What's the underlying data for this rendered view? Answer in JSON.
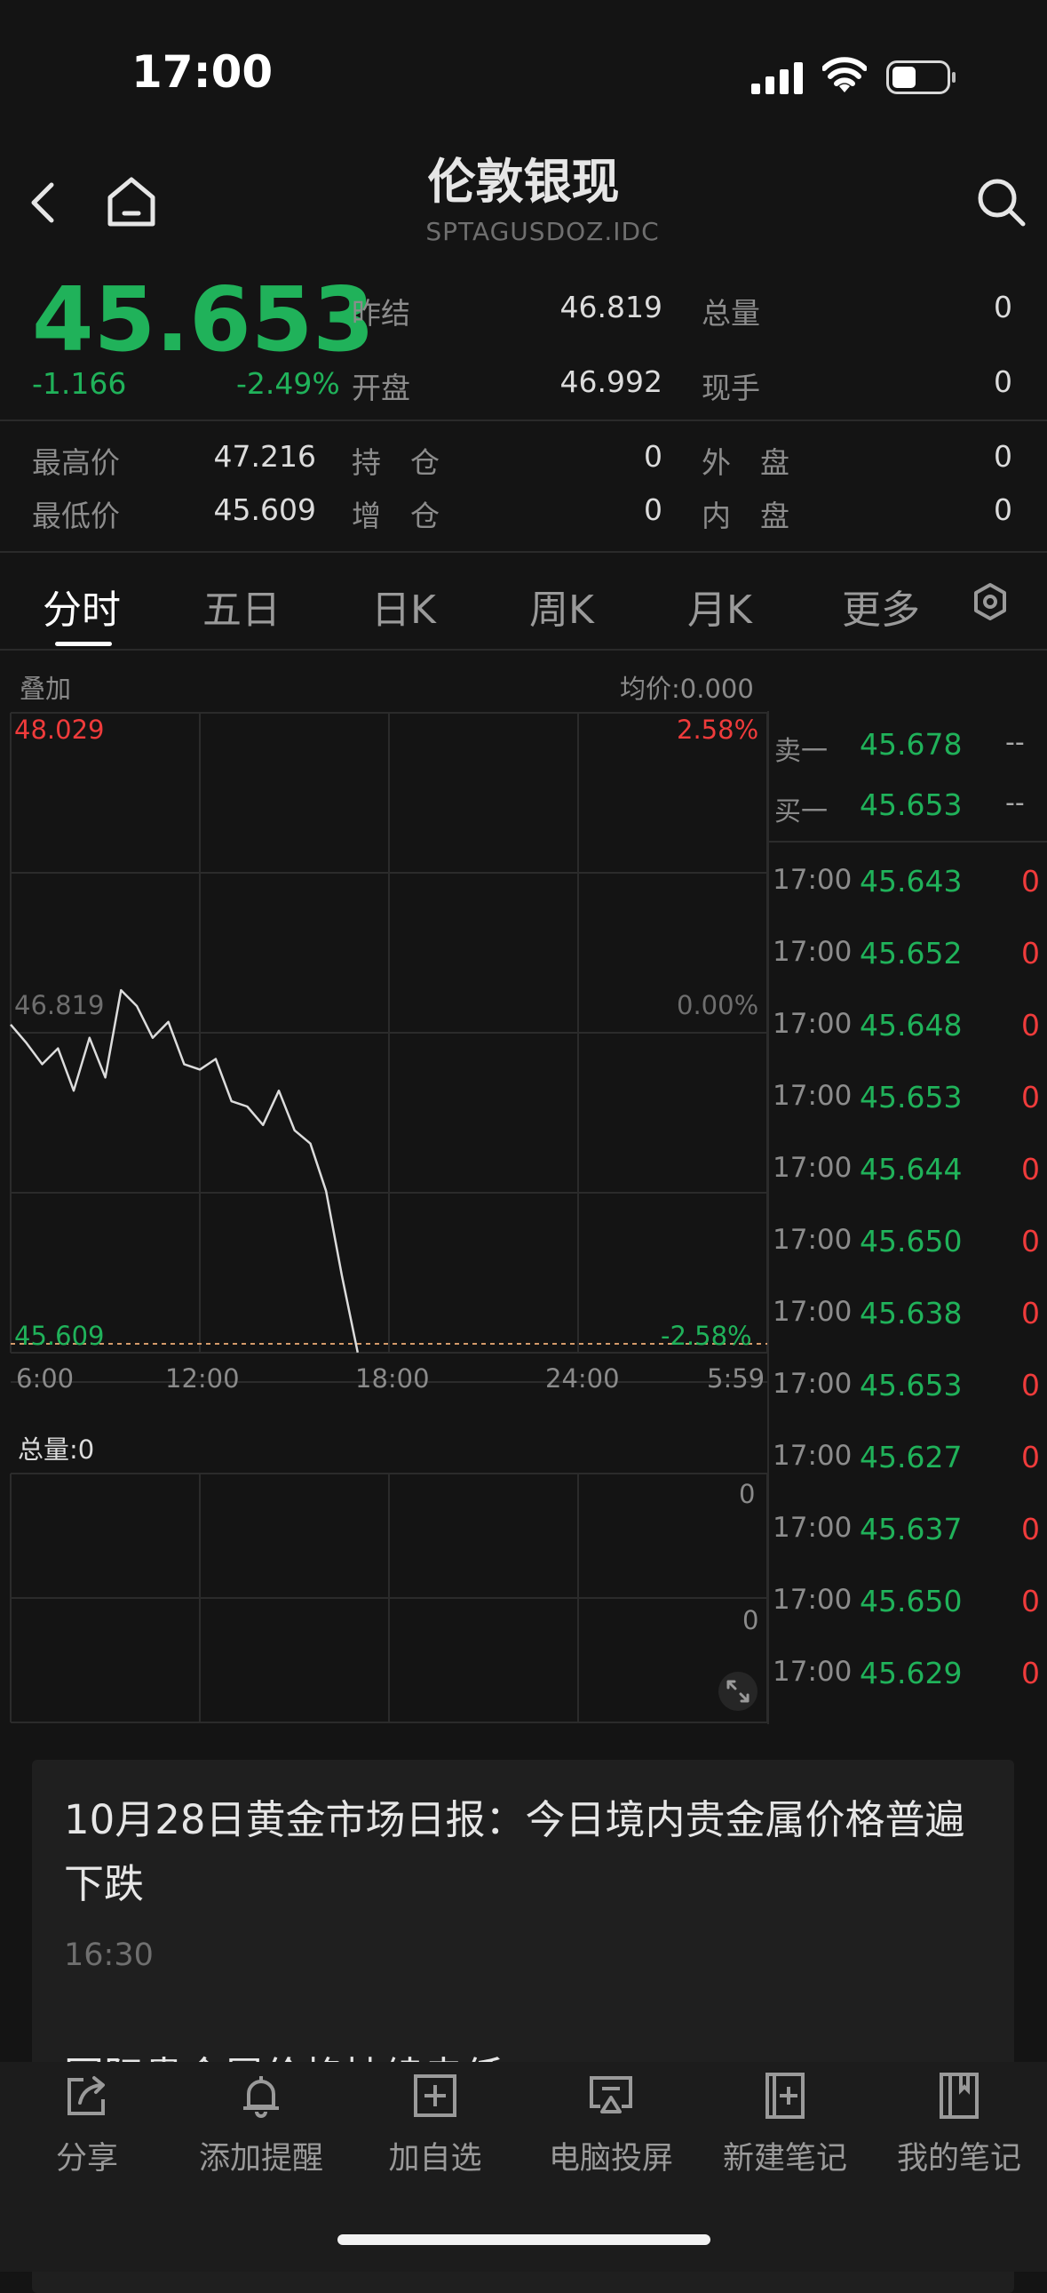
{
  "status": {
    "time": "17:00"
  },
  "header": {
    "title": "伦敦银现",
    "code": "SPTAGUSDOZ.IDC"
  },
  "quote": {
    "price": "45.653",
    "change": "-1.166",
    "change_pct": "-2.49%",
    "fields": [
      {
        "label": "昨结",
        "value": "46.819"
      },
      {
        "label": "开盘",
        "value": "46.992"
      },
      {
        "label": "总量",
        "value": "0"
      },
      {
        "label": "现手",
        "value": "0"
      },
      {
        "label": "最高价",
        "value": "47.216"
      },
      {
        "label": "最低价",
        "value": "45.609"
      },
      {
        "label": "持　仓",
        "value": "0"
      },
      {
        "label": "增　仓",
        "value": "0"
      },
      {
        "label": "外　盘",
        "value": "0"
      },
      {
        "label": "内　盘",
        "value": "0"
      }
    ]
  },
  "tabs": [
    "分时",
    "五日",
    "日K",
    "周K",
    "月K",
    "更多"
  ],
  "chart": {
    "overlay_label": "叠加",
    "avg_label": "均价:0.000",
    "y_high": "48.029",
    "y_high_pct": "2.58%",
    "y_mid": "46.819",
    "y_mid_pct": "0.00%",
    "y_low": "45.609",
    "y_low_pct": "-2.58%",
    "x_ticks": [
      "6:00",
      "12:00",
      "18:00",
      "24:00",
      "5:59"
    ],
    "volume_label": "总量:0",
    "vol_tick_top": "0",
    "vol_tick_mid": "0"
  },
  "chart_data": {
    "type": "line",
    "title": "",
    "xlabel": "",
    "ylabel": "",
    "x": [
      "06:00",
      "06:30",
      "07:00",
      "07:30",
      "08:00",
      "08:30",
      "09:00",
      "09:30",
      "10:00",
      "10:30",
      "11:00",
      "11:30",
      "12:00",
      "12:30",
      "13:00",
      "13:30",
      "14:00",
      "14:30",
      "15:00",
      "15:30",
      "16:00",
      "16:30",
      "17:00"
    ],
    "series": [
      {
        "values": [
          46.85,
          46.78,
          46.7,
          46.76,
          46.6,
          46.8,
          46.65,
          46.98,
          46.92,
          46.8,
          46.86,
          46.7,
          46.68,
          46.72,
          46.56,
          46.54,
          46.47,
          46.6,
          46.45,
          46.4,
          46.22,
          45.9,
          45.61
        ]
      }
    ],
    "ylim": [
      45.609,
      48.029
    ],
    "grid": true
  },
  "orderbook": {
    "rows": [
      {
        "label": "卖一",
        "price": "45.678",
        "vol": "--"
      },
      {
        "label": "买一",
        "price": "45.653",
        "vol": "--"
      }
    ],
    "ticks": [
      {
        "time": "17:00",
        "price": "45.643",
        "vol": "0"
      },
      {
        "time": "17:00",
        "price": "45.652",
        "vol": "0"
      },
      {
        "time": "17:00",
        "price": "45.648",
        "vol": "0"
      },
      {
        "time": "17:00",
        "price": "45.653",
        "vol": "0"
      },
      {
        "time": "17:00",
        "price": "45.644",
        "vol": "0"
      },
      {
        "time": "17:00",
        "price": "45.650",
        "vol": "0"
      },
      {
        "time": "17:00",
        "price": "45.638",
        "vol": "0"
      },
      {
        "time": "17:00",
        "price": "45.653",
        "vol": "0"
      },
      {
        "time": "17:00",
        "price": "45.627",
        "vol": "0"
      },
      {
        "time": "17:00",
        "price": "45.637",
        "vol": "0"
      },
      {
        "time": "17:00",
        "price": "45.650",
        "vol": "0"
      },
      {
        "time": "17:00",
        "price": "45.629",
        "vol": "0"
      }
    ]
  },
  "news": {
    "title": "10月28日黄金市场日报：今日境内贵金属价格普遍下跌",
    "time": "16:30",
    "next_title": "国际贵金属价格持续走低"
  },
  "bottombar": [
    {
      "label": "分享",
      "icon": "share-icon"
    },
    {
      "label": "添加提醒",
      "icon": "bell-icon"
    },
    {
      "label": "加自选",
      "icon": "add-watchlist-icon"
    },
    {
      "label": "电脑投屏",
      "icon": "screen-cast-icon"
    },
    {
      "label": "新建笔记",
      "icon": "new-note-icon"
    },
    {
      "label": "我的笔记",
      "icon": "notebook-icon"
    }
  ],
  "colors": {
    "up": "#ef3b3b",
    "down": "#20b25a",
    "background": "#141414",
    "line": "#d9d9d9"
  }
}
